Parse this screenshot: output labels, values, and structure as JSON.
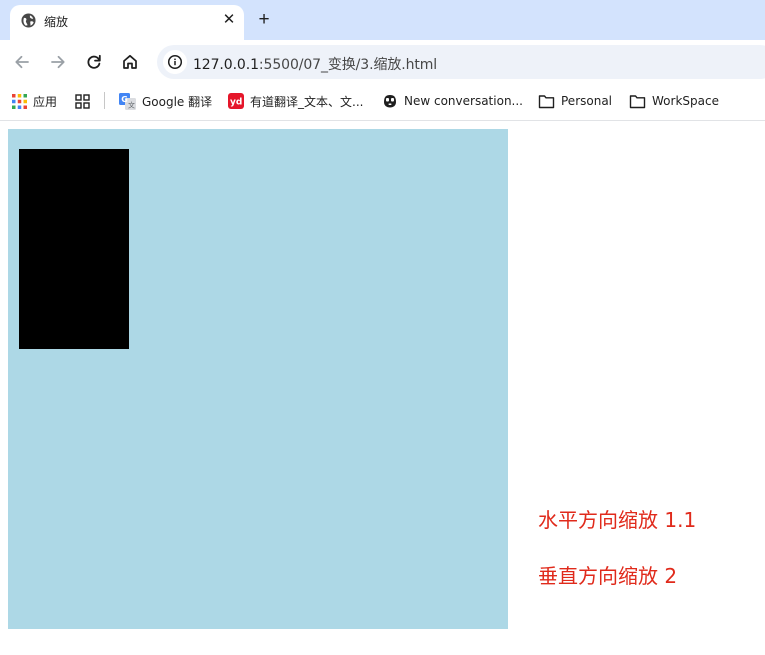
{
  "tab": {
    "title": "缩放",
    "close_glyph": "✕",
    "new_tab_glyph": "+"
  },
  "toolbar": {
    "icons": [
      "back-icon",
      "forward-icon",
      "reload-icon",
      "home-icon",
      "info-icon"
    ]
  },
  "address": {
    "host": "127.0.0.1",
    "path": ":5500/07_变换/3.缩放.html"
  },
  "bookmarks": [
    {
      "label": "应用",
      "icon": "apps-grid-icon"
    },
    {
      "label": "",
      "icon": "tab-groups-icon"
    },
    {
      "label": "Google 翻译",
      "icon": "google-translate-icon"
    },
    {
      "label": "有道翻译_文本、文...",
      "icon": "youdao-icon"
    },
    {
      "label": "New conversation...",
      "icon": "copilot-icon"
    },
    {
      "label": "Personal",
      "icon": "folder-icon"
    },
    {
      "label": "WorkSpace",
      "icon": "folder-icon"
    }
  ],
  "page": {
    "horizontal_caption": "水平方向缩放 1.1",
    "vertical_caption": "垂直方向缩放 2",
    "colors": {
      "box": "#add8e6",
      "scaled_element": "#000000",
      "caption": "#e02a1b"
    }
  }
}
